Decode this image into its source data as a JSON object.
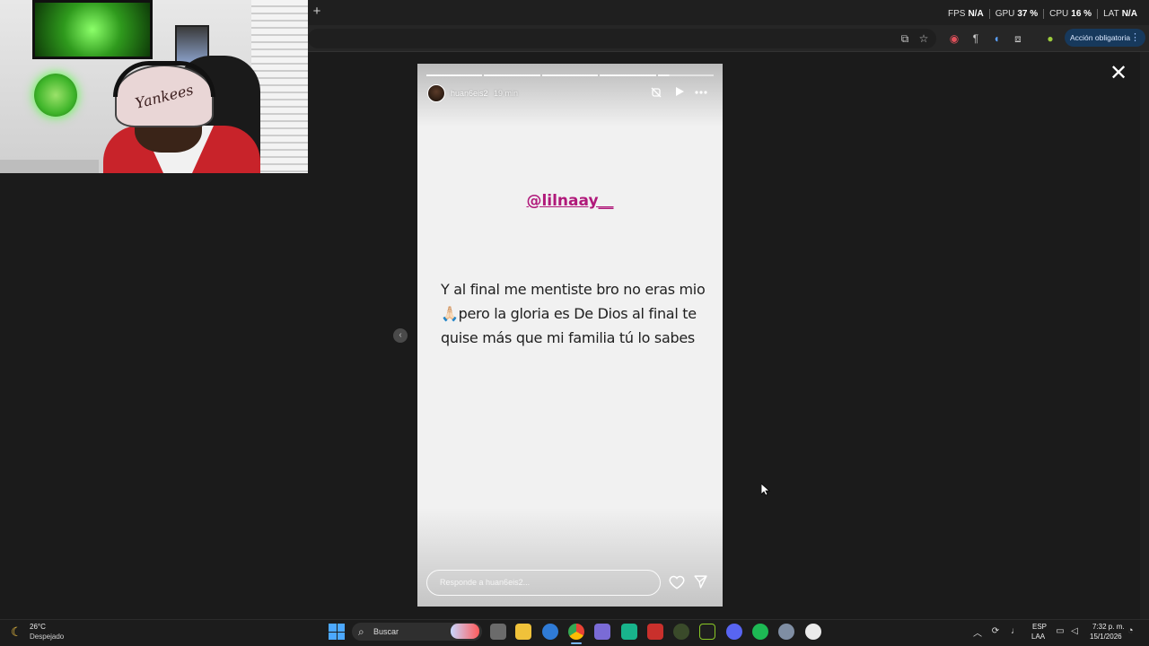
{
  "browser": {
    "new_tab_symbol": "+",
    "action_button_label": "Acción obligatoria",
    "action_button_menu": "⋮"
  },
  "perf_overlay": {
    "fps_label": "FPS",
    "fps_value": "N/A",
    "gpu_label": "GPU",
    "gpu_value": "37 %",
    "cpu_label": "CPU",
    "cpu_value": "16 %",
    "lat_label": "LAT",
    "lat_value": "N/A"
  },
  "webcam": {
    "cap_text": "Yankees"
  },
  "story": {
    "username": "huan6eis2",
    "time_ago": "19 min",
    "mention": "@lilnaay__",
    "body_text": "Y al final me mentiste bro no eras mio 🙏🏻pero la gloria es De Dios al final te quise más que mi familia tú lo sabes",
    "reply_placeholder": "Responde a huan6eis2...",
    "progress": [
      1,
      1,
      1,
      1,
      0.2
    ]
  },
  "viewer": {
    "close_symbol": "✕",
    "prev_symbol": "‹"
  },
  "taskbar": {
    "weather_temp": "26°C",
    "weather_desc": "Despejado",
    "search_label": "Buscar",
    "lang_top": "ESP",
    "lang_bottom": "LAA",
    "time": "7:32 p. m.",
    "date": "15/1/2026"
  },
  "colors": {
    "mention": "#b0197a",
    "accent": "#4ca8ff",
    "action_button": "#17395c"
  }
}
